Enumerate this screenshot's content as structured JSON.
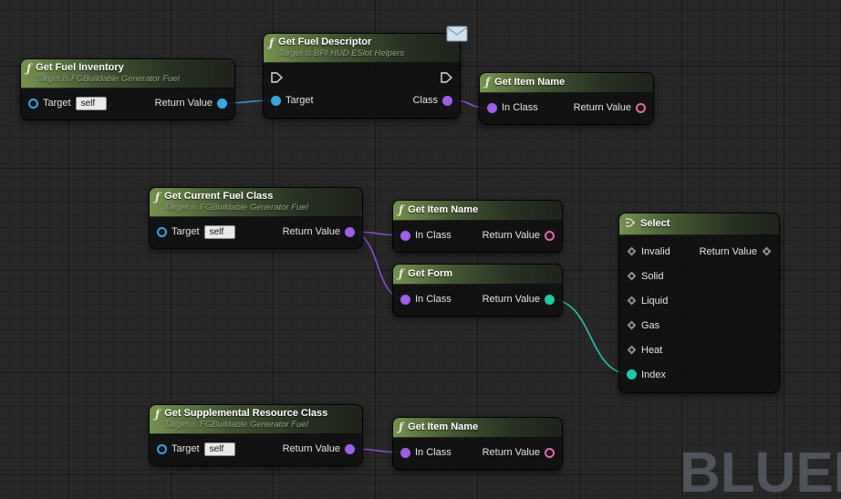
{
  "watermark": "BLUEP",
  "icons": {
    "function": "ƒ"
  },
  "colors": {
    "pin_object": "#35a7e0",
    "pin_class": "#9e5ee8",
    "pin_text": "#e868a8",
    "pin_enum": "#1dc9a4",
    "pin_wildcard": "#8f8f8f",
    "header_green": "#7a9852"
  },
  "nodes": [
    {
      "title": "Get Fuel Inventory",
      "subtitle": "Target is FGBuildable Generator Fuel",
      "pins_left": [
        {
          "label": "Target",
          "value": "self"
        }
      ],
      "pins_right": [
        {
          "label": "Return Value"
        }
      ]
    },
    {
      "title": "Get Fuel Descriptor",
      "subtitle": "Target is BPI HUD ESlot Helpers",
      "pins_left": [
        {
          "label": "Target"
        }
      ],
      "pins_right": [
        {
          "label": "Class"
        }
      ]
    },
    {
      "title": "Get Item Name",
      "pins_left": [
        {
          "label": "In Class"
        }
      ],
      "pins_right": [
        {
          "label": "Return Value"
        }
      ]
    },
    {
      "title": "Get Current Fuel Class",
      "subtitle": "Target is FGBuildable Generator Fuel",
      "pins_left": [
        {
          "label": "Target",
          "value": "self"
        }
      ],
      "pins_right": [
        {
          "label": "Return Value"
        }
      ]
    },
    {
      "title": "Get Item Name",
      "pins_left": [
        {
          "label": "In Class"
        }
      ],
      "pins_right": [
        {
          "label": "Return Value"
        }
      ]
    },
    {
      "title": "Get Form",
      "pins_left": [
        {
          "label": "In Class"
        }
      ],
      "pins_right": [
        {
          "label": "Return Value"
        }
      ]
    },
    {
      "title": "Select",
      "pins_left": [
        {
          "label": "Invalid"
        },
        {
          "label": "Solid"
        },
        {
          "label": "Liquid"
        },
        {
          "label": "Gas"
        },
        {
          "label": "Heat"
        },
        {
          "label": "Index"
        }
      ],
      "pins_right": [
        {
          "label": "Return Value"
        }
      ]
    },
    {
      "title": "Get Supplemental Resource Class",
      "subtitle": "Target is FGBuildable Generator Fuel",
      "pins_left": [
        {
          "label": "Target",
          "value": "self"
        }
      ],
      "pins_right": [
        {
          "label": "Return Value"
        }
      ]
    },
    {
      "title": "Get Item Name",
      "pins_left": [
        {
          "label": "In Class"
        }
      ],
      "pins_right": [
        {
          "label": "Return Value"
        }
      ]
    }
  ],
  "wires": [
    {
      "from": "pin-fuelinv-out",
      "to": "pin-fueldesc-target",
      "color": "#2f9fe0"
    },
    {
      "from": "pin-fueldesc-class",
      "to": "pin-itemname1-in",
      "color": "#8a4fd8"
    },
    {
      "from": "pin-curfuel-out",
      "to": "pin-itemname2-in",
      "color": "#8a4fd8"
    },
    {
      "from": "pin-curfuel-out",
      "to": "pin-getform-in",
      "color": "#8a4fd8"
    },
    {
      "from": "pin-getform-out",
      "to": "pin-select-index",
      "color": "#2fbfae"
    },
    {
      "from": "pin-supres-out",
      "to": "pin-itemname3-in",
      "color": "#8a4fd8"
    }
  ]
}
